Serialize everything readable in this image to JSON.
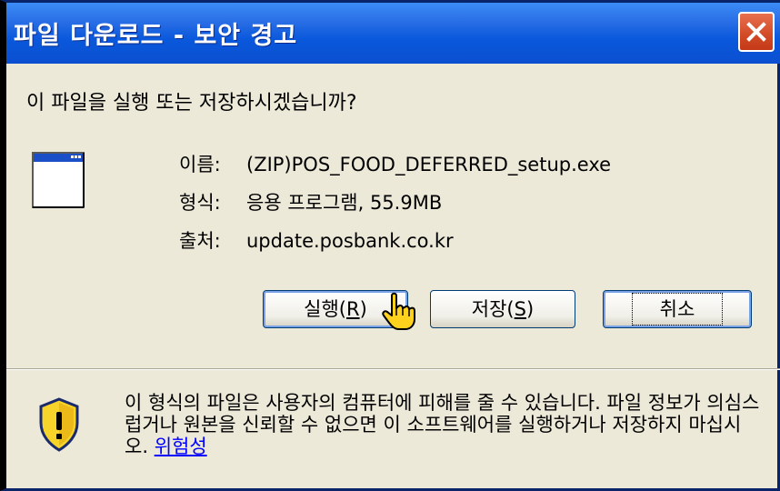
{
  "window": {
    "title": "파일 다운로드 - 보안 경고",
    "close_icon": "close-icon"
  },
  "question": "이 파일을 실행 또는 저장하시겠습니까?",
  "file": {
    "icon": "window-file-icon",
    "name_label": "이름:",
    "name_value": "(ZIP)POS_FOOD_DEFERRED_setup.exe",
    "type_label": "형식:",
    "type_value": "응용 프로그램, 55.9MB",
    "source_label": "출처:",
    "source_value": "update.posbank.co.kr"
  },
  "buttons": {
    "run_label": "실행(",
    "run_mnemonic": "R",
    "run_suffix": ")",
    "save_label": "저장(",
    "save_mnemonic": "S",
    "save_suffix": ")",
    "cancel_label": "취소"
  },
  "warning": {
    "icon": "shield-warning-icon",
    "text": "이 형식의 파일은 사용자의 컴퓨터에 피해를 줄 수 있습니다. 파일 정보가 의심스럽거나 원본을 신뢰할 수 없으면 이 소프트웨어를 실행하거나 저장하지 마십시오.",
    "link": "위험성"
  },
  "cursor": "hand-pointer-icon",
  "colors": {
    "titlebar": "#0b4fd0",
    "dialog_bg": "#ece9d8",
    "close": "#d24a26",
    "link": "#0000ff"
  }
}
